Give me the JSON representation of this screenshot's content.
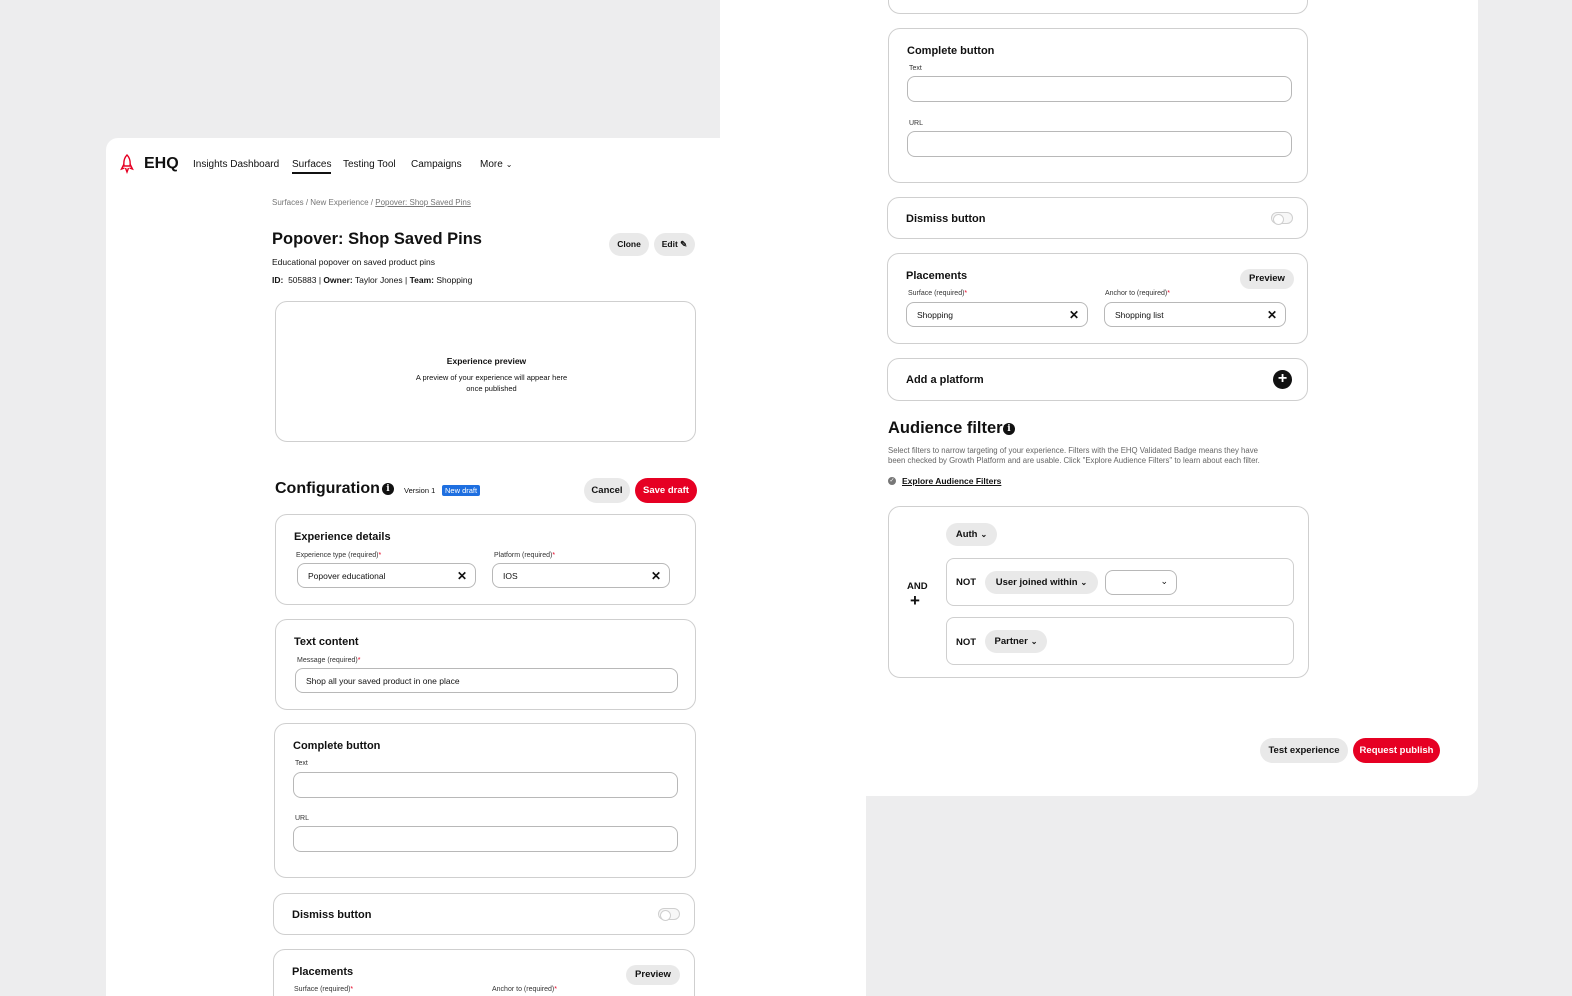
{
  "back": {
    "complete_button": {
      "title": "Complete button",
      "text_label": "Text",
      "url_label": "URL"
    },
    "dismiss_button": {
      "title": "Dismiss button",
      "enabled": false
    },
    "placements": {
      "title": "Placements",
      "preview_label": "Preview",
      "surface_label": "Surface (required)",
      "surface_value": "Shopping",
      "anchor_label": "Anchor to (required)",
      "anchor_value": "Shopping list"
    },
    "add_platform": {
      "label": "Add a platform"
    },
    "audience_filters": {
      "title": "Audience filters",
      "description_line1": "Select filters to narrow targeting of your experience. Filters with the EHQ Validated Badge means they have",
      "description_line2": "been checked by Growth Platform and are usable. Click \"Explore Audience Filters\" to learn about each filter.",
      "explore_link": "Explore Audience Filters",
      "auth_pill": "Auth",
      "operator": "AND",
      "add_symbol": "+",
      "rows": [
        {
          "not_label": "NOT",
          "filter": "User joined within",
          "value": ""
        },
        {
          "not_label": "NOT",
          "filter": "Partner"
        }
      ]
    },
    "actions": {
      "test_label": "Test experience",
      "publish_label": "Request publish"
    }
  },
  "front": {
    "app_name": "EHQ",
    "nav": [
      "Insights Dashboard",
      "Surfaces",
      "Testing Tool",
      "Campaigns",
      "More"
    ],
    "breadcrumb": {
      "part1": "Surfaces",
      "sep": "/",
      "part2": "New Experience",
      "current": "Popover: Shop Saved Pins"
    },
    "title": "Popover: Shop Saved Pins",
    "subtitle": "Educational popover on saved product pins",
    "meta": {
      "id_label": "ID:",
      "id_value": "505883",
      "owner_label": "Owner:",
      "owner_value": "Taylor Jones",
      "team_label": "Team:",
      "team_value": "Shopping",
      "divider": "|"
    },
    "clone_label": "Clone",
    "edit_label": "Edit",
    "preview": {
      "title": "Experience preview",
      "line1": "A preview of your experience will appear here",
      "line2": "once published"
    },
    "configuration": {
      "title": "Configuration",
      "version": "Version 1",
      "badge": "New draft",
      "cancel_label": "Cancel",
      "save_label": "Save draft"
    },
    "experience_details": {
      "title": "Experience details",
      "type_label": "Experience type (required)",
      "type_value": "Popover educational",
      "platform_label": "Platform (required)",
      "platform_value": "IOS"
    },
    "text_content": {
      "title": "Text content",
      "message_label": "Message (required)",
      "message_value": "Shop all your saved product in one place"
    },
    "complete_button": {
      "title": "Complete button",
      "text_label": "Text",
      "url_label": "URL"
    },
    "dismiss_button": {
      "title": "Dismiss button",
      "enabled": false
    },
    "placements": {
      "title": "Placements",
      "preview_label": "Preview",
      "surface_label": "Surface (required)",
      "anchor_label": "Anchor to (required)"
    }
  },
  "colors": {
    "accent": "#e60023",
    "badge": "#1e6fe0",
    "text": "#111111",
    "background": "#ededee"
  },
  "icons": [
    "rocket-logo-icon",
    "chevron-down-icon",
    "pencil-icon",
    "info-icon",
    "close-icon",
    "plus-circle-icon",
    "badge-check-icon"
  ]
}
